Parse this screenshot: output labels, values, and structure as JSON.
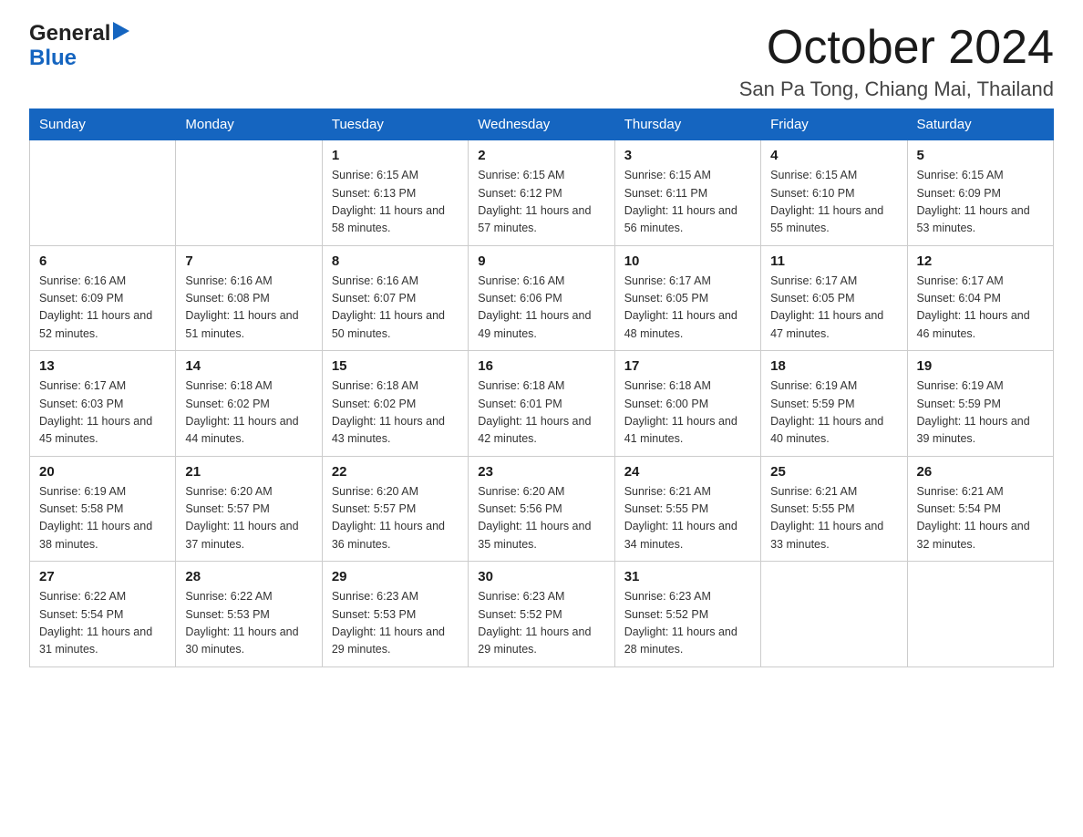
{
  "header": {
    "logo_general": "General",
    "logo_blue": "Blue",
    "month_title": "October 2024",
    "location": "San Pa Tong, Chiang Mai, Thailand"
  },
  "days_of_week": [
    "Sunday",
    "Monday",
    "Tuesday",
    "Wednesday",
    "Thursday",
    "Friday",
    "Saturday"
  ],
  "weeks": [
    [
      {
        "day": "",
        "sunrise": "",
        "sunset": "",
        "daylight": ""
      },
      {
        "day": "",
        "sunrise": "",
        "sunset": "",
        "daylight": ""
      },
      {
        "day": "1",
        "sunrise": "Sunrise: 6:15 AM",
        "sunset": "Sunset: 6:13 PM",
        "daylight": "Daylight: 11 hours and 58 minutes."
      },
      {
        "day": "2",
        "sunrise": "Sunrise: 6:15 AM",
        "sunset": "Sunset: 6:12 PM",
        "daylight": "Daylight: 11 hours and 57 minutes."
      },
      {
        "day": "3",
        "sunrise": "Sunrise: 6:15 AM",
        "sunset": "Sunset: 6:11 PM",
        "daylight": "Daylight: 11 hours and 56 minutes."
      },
      {
        "day": "4",
        "sunrise": "Sunrise: 6:15 AM",
        "sunset": "Sunset: 6:10 PM",
        "daylight": "Daylight: 11 hours and 55 minutes."
      },
      {
        "day": "5",
        "sunrise": "Sunrise: 6:15 AM",
        "sunset": "Sunset: 6:09 PM",
        "daylight": "Daylight: 11 hours and 53 minutes."
      }
    ],
    [
      {
        "day": "6",
        "sunrise": "Sunrise: 6:16 AM",
        "sunset": "Sunset: 6:09 PM",
        "daylight": "Daylight: 11 hours and 52 minutes."
      },
      {
        "day": "7",
        "sunrise": "Sunrise: 6:16 AM",
        "sunset": "Sunset: 6:08 PM",
        "daylight": "Daylight: 11 hours and 51 minutes."
      },
      {
        "day": "8",
        "sunrise": "Sunrise: 6:16 AM",
        "sunset": "Sunset: 6:07 PM",
        "daylight": "Daylight: 11 hours and 50 minutes."
      },
      {
        "day": "9",
        "sunrise": "Sunrise: 6:16 AM",
        "sunset": "Sunset: 6:06 PM",
        "daylight": "Daylight: 11 hours and 49 minutes."
      },
      {
        "day": "10",
        "sunrise": "Sunrise: 6:17 AM",
        "sunset": "Sunset: 6:05 PM",
        "daylight": "Daylight: 11 hours and 48 minutes."
      },
      {
        "day": "11",
        "sunrise": "Sunrise: 6:17 AM",
        "sunset": "Sunset: 6:05 PM",
        "daylight": "Daylight: 11 hours and 47 minutes."
      },
      {
        "day": "12",
        "sunrise": "Sunrise: 6:17 AM",
        "sunset": "Sunset: 6:04 PM",
        "daylight": "Daylight: 11 hours and 46 minutes."
      }
    ],
    [
      {
        "day": "13",
        "sunrise": "Sunrise: 6:17 AM",
        "sunset": "Sunset: 6:03 PM",
        "daylight": "Daylight: 11 hours and 45 minutes."
      },
      {
        "day": "14",
        "sunrise": "Sunrise: 6:18 AM",
        "sunset": "Sunset: 6:02 PM",
        "daylight": "Daylight: 11 hours and 44 minutes."
      },
      {
        "day": "15",
        "sunrise": "Sunrise: 6:18 AM",
        "sunset": "Sunset: 6:02 PM",
        "daylight": "Daylight: 11 hours and 43 minutes."
      },
      {
        "day": "16",
        "sunrise": "Sunrise: 6:18 AM",
        "sunset": "Sunset: 6:01 PM",
        "daylight": "Daylight: 11 hours and 42 minutes."
      },
      {
        "day": "17",
        "sunrise": "Sunrise: 6:18 AM",
        "sunset": "Sunset: 6:00 PM",
        "daylight": "Daylight: 11 hours and 41 minutes."
      },
      {
        "day": "18",
        "sunrise": "Sunrise: 6:19 AM",
        "sunset": "Sunset: 5:59 PM",
        "daylight": "Daylight: 11 hours and 40 minutes."
      },
      {
        "day": "19",
        "sunrise": "Sunrise: 6:19 AM",
        "sunset": "Sunset: 5:59 PM",
        "daylight": "Daylight: 11 hours and 39 minutes."
      }
    ],
    [
      {
        "day": "20",
        "sunrise": "Sunrise: 6:19 AM",
        "sunset": "Sunset: 5:58 PM",
        "daylight": "Daylight: 11 hours and 38 minutes."
      },
      {
        "day": "21",
        "sunrise": "Sunrise: 6:20 AM",
        "sunset": "Sunset: 5:57 PM",
        "daylight": "Daylight: 11 hours and 37 minutes."
      },
      {
        "day": "22",
        "sunrise": "Sunrise: 6:20 AM",
        "sunset": "Sunset: 5:57 PM",
        "daylight": "Daylight: 11 hours and 36 minutes."
      },
      {
        "day": "23",
        "sunrise": "Sunrise: 6:20 AM",
        "sunset": "Sunset: 5:56 PM",
        "daylight": "Daylight: 11 hours and 35 minutes."
      },
      {
        "day": "24",
        "sunrise": "Sunrise: 6:21 AM",
        "sunset": "Sunset: 5:55 PM",
        "daylight": "Daylight: 11 hours and 34 minutes."
      },
      {
        "day": "25",
        "sunrise": "Sunrise: 6:21 AM",
        "sunset": "Sunset: 5:55 PM",
        "daylight": "Daylight: 11 hours and 33 minutes."
      },
      {
        "day": "26",
        "sunrise": "Sunrise: 6:21 AM",
        "sunset": "Sunset: 5:54 PM",
        "daylight": "Daylight: 11 hours and 32 minutes."
      }
    ],
    [
      {
        "day": "27",
        "sunrise": "Sunrise: 6:22 AM",
        "sunset": "Sunset: 5:54 PM",
        "daylight": "Daylight: 11 hours and 31 minutes."
      },
      {
        "day": "28",
        "sunrise": "Sunrise: 6:22 AM",
        "sunset": "Sunset: 5:53 PM",
        "daylight": "Daylight: 11 hours and 30 minutes."
      },
      {
        "day": "29",
        "sunrise": "Sunrise: 6:23 AM",
        "sunset": "Sunset: 5:53 PM",
        "daylight": "Daylight: 11 hours and 29 minutes."
      },
      {
        "day": "30",
        "sunrise": "Sunrise: 6:23 AM",
        "sunset": "Sunset: 5:52 PM",
        "daylight": "Daylight: 11 hours and 29 minutes."
      },
      {
        "day": "31",
        "sunrise": "Sunrise: 6:23 AM",
        "sunset": "Sunset: 5:52 PM",
        "daylight": "Daylight: 11 hours and 28 minutes."
      },
      {
        "day": "",
        "sunrise": "",
        "sunset": "",
        "daylight": ""
      },
      {
        "day": "",
        "sunrise": "",
        "sunset": "",
        "daylight": ""
      }
    ]
  ]
}
